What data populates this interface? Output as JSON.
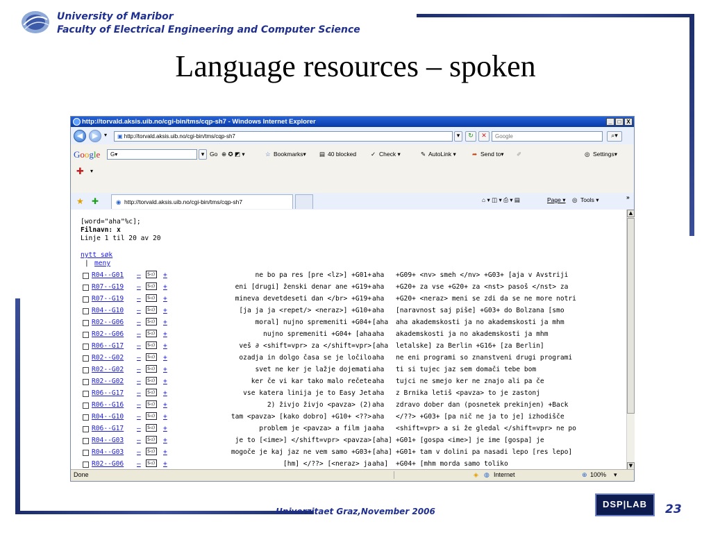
{
  "slide": {
    "university": "University of Maribor",
    "faculty": "Faculty of Electrical Engineering and Computer Science",
    "title": "Language resources – spoken",
    "footer": "Univerzitaet Graz,November 2006",
    "logo_text": "DSP|LAB",
    "page_number": "23",
    "colors": {
      "accent": "#1f2f8f",
      "bar": "#2a3c85"
    }
  },
  "browser": {
    "window_title": "http://torvald.aksis.uib.no/cgi-bin/tms/cqp-sh7 - Windows Internet Explorer",
    "window_buttons": [
      "_",
      "□",
      "X"
    ],
    "address": "http://torvald.aksis.uib.no/cgi-bin/tms/cqp-sh7",
    "search_placeholder": "Google",
    "google_toolbar": {
      "brand": "Google",
      "search_box": "G▾",
      "go": "Go",
      "bookmarks": "Bookmarks▾",
      "blocked": "40 blocked",
      "check": "Check ▾",
      "autolink": "AutoLink ▾",
      "sendto": "Send to▾",
      "settings": "Settings▾"
    },
    "tab_title": "http://torvald.aksis.uib.no/cgi-bin/tms/cqp-sh7",
    "command_bar": {
      "page": "Page ▾",
      "tools": "Tools ▾",
      "more": "»"
    },
    "status": {
      "text": "Done",
      "zone": "Internet",
      "zoom": "100%"
    }
  },
  "query": {
    "line1": "[word=\"aha\"%c];",
    "line2": "Filnavn: x",
    "line3": "Linje 1 til 20 av 20",
    "new_search": "nytt søk",
    "menu_prefix": "|",
    "menu": "meny",
    "speaker_label": "S◁)",
    "dash": "–",
    "plus": "+"
  },
  "results": [
    {
      "id": "R04--G01",
      "left": "ne bo pa res [pre <lz>] +G01+",
      "kw": "aha",
      "right": "+G09+ <nv> smeh </nv> +G03+ [aja v Avstriji"
    },
    {
      "id": "R07--G19",
      "left": "eni [drugi] ženski denar ane +G19+",
      "kw": "aha",
      "right": "+G20+ za vse +G20+ za <nst> pasoš </nst> za"
    },
    {
      "id": "R07--G19",
      "left": "mineva devetdeseti dan </br> +G19+",
      "kw": "aha",
      "right": "+G20+ <neraz> meni se zdi da se ne more notri"
    },
    {
      "id": "R04--G10",
      "left": "[ja ja ja <repet/> <neraz>] +G10+",
      "kw": "aha",
      "right": "[naravnost saj piše] +G03+ do Bolzana [smo"
    },
    {
      "id": "R02--G06",
      "left": "moral] nujno spremeniti +G04+",
      "kw": "[aha",
      "right": "aha akademskosti ja no akademskosti ja mhm"
    },
    {
      "id": "R02--G06",
      "left": "nujno spremeniti +G04+ [aha",
      "kw": "aha",
      "right": "akademskosti ja no akademskosti ja mhm"
    },
    {
      "id": "R06--G17",
      "left": "veš ∂ <shift=vpr> za </shift=vpr>",
      "kw": "[aha",
      "right": "letalske] za Berlin +G16+ [za Berlin]"
    },
    {
      "id": "R02--G02",
      "left": "ozadja in dolgo časa se je ločilo",
      "kw": "aha",
      "right": "ne eni programi so znanstveni drugi programi"
    },
    {
      "id": "R02--G02",
      "left": "svet ne ker je lažje dojemati",
      "kw": "aha",
      "right": "ti si tujec jaz sem domači tebe bom"
    },
    {
      "id": "R02--G02",
      "left": "ker če vi kar tako malo rečete",
      "kw": "aha",
      "right": "tujci ne smejo ker ne znajo ali pa če"
    },
    {
      "id": "R06--G17",
      "left": "vse katera linija je to Easy Jet",
      "kw": "aha",
      "right": "z Brnika letiš <pavza> to je zastonj"
    },
    {
      "id": "R06--G16",
      "left": "2) živjo živjo <pavza> (2)",
      "kw": "aha",
      "right": "zdravo dober dan (posnetek prekinjen) +Back"
    },
    {
      "id": "R04--G10",
      "left": "tam <pavza> [kako dobro] +G10+ <??>",
      "kw": "aha",
      "right": "</??> +G03+ [pa nič ne ja to je] izhodišče"
    },
    {
      "id": "R06--G17",
      "left": "problem je <pavza> a film ja",
      "kw": "aha",
      "right": "<shift=vpr> a si že gledal </shift=vpr> ne po"
    },
    {
      "id": "R04--G03",
      "left": "je to [<ime>] </shift=vpr> <pavza>",
      "kw": "[aha]",
      "right": "+G01+ [gospa <ime>] je ime [gospa] je"
    },
    {
      "id": "R04--G03",
      "left": "mogoče je kaj jaz ne vem samo +G03+",
      "kw": "[aha]",
      "right": "+G01+ tam v dolini pa nasadi lepo [res lepo]"
    },
    {
      "id": "R02--G06",
      "left": "[hm] </??> [<neraz> ja",
      "kw": "aha]",
      "right": "+G04+ [mhm morda samo toliko"
    }
  ]
}
